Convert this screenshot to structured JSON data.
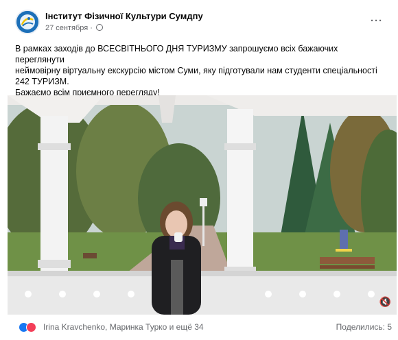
{
  "post": {
    "page_name": "Інститут Фізичної Культури Сумдпу",
    "date": "27 сентября",
    "separator": "·",
    "more_label": "···",
    "text_lines": [
      "В рамках заходів до ВСЕСВІТНЬОГО ДНЯ ТУРИЗМУ запрошуємо всіх бажаючих переглянути",
      "неймовірну віртуальну екскурсію містом Суми, яку підготували нам студенти спеціальності",
      "242 ТУРИЗМ.",
      "Бажаємо всім приємного перегляду!"
    ]
  },
  "video": {
    "mute_icon": "muted-speaker-icon"
  },
  "footer": {
    "reactions": [
      "like-icon",
      "love-icon"
    ],
    "reactors_text": "Irina Kravchenko, Маринка Турко и ещё 34",
    "shares_text": "Поделились: 5"
  },
  "colors": {
    "like": "#1877f2",
    "love": "#f33e58",
    "secondary_text": "#65676b",
    "avatar": "#1c6fb8"
  }
}
